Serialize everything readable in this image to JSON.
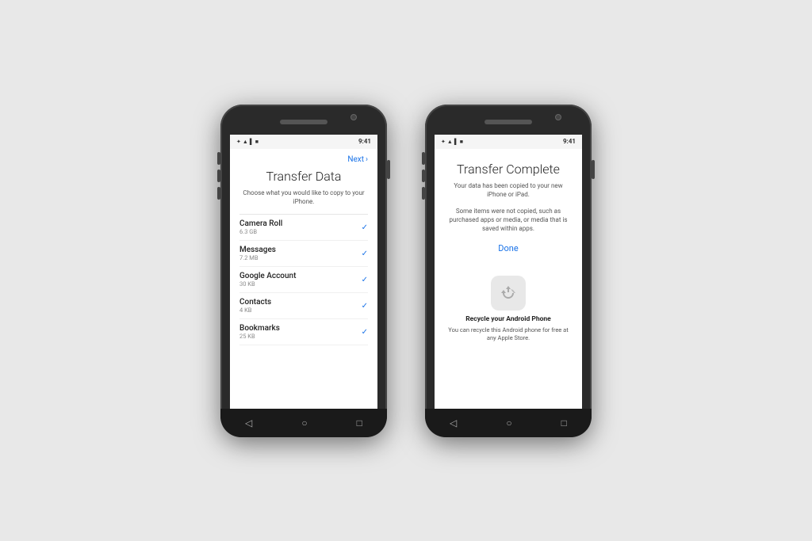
{
  "background_color": "#e8e8e8",
  "phone_left": {
    "status_bar": {
      "bluetooth": "✦",
      "wifi": "▲",
      "signal": "▌",
      "battery": "■",
      "time": "9:41"
    },
    "next_button_label": "Next",
    "screen_title": "Transfer Data",
    "screen_subtitle": "Choose what you would like to copy to your iPhone.",
    "transfer_items": [
      {
        "name": "Camera Roll",
        "size": "6.3 GB",
        "checked": true
      },
      {
        "name": "Messages",
        "size": "7.2 MB",
        "checked": true
      },
      {
        "name": "Google Account",
        "size": "30 KB",
        "checked": true
      },
      {
        "name": "Contacts",
        "size": "4 KB",
        "checked": true
      },
      {
        "name": "Bookmarks",
        "size": "25 KB",
        "checked": true
      }
    ],
    "nav": {
      "back": "◁",
      "home": "○",
      "recent": "□"
    }
  },
  "phone_right": {
    "status_bar": {
      "bluetooth": "✦",
      "wifi": "▲",
      "signal": "▌",
      "battery": "■",
      "time": "9:41"
    },
    "screen_title": "Transfer Complete",
    "screen_subtitle": "Your data has been copied to your new iPhone or iPad.",
    "screen_note": "Some items were not copied, such as purchased apps or media, or media that is saved within apps.",
    "done_button_label": "Done",
    "recycle_title": "Recycle your Android Phone",
    "recycle_description": "You can recycle this Android phone for free at any Apple Store.",
    "nav": {
      "back": "◁",
      "home": "○",
      "recent": "□"
    }
  }
}
